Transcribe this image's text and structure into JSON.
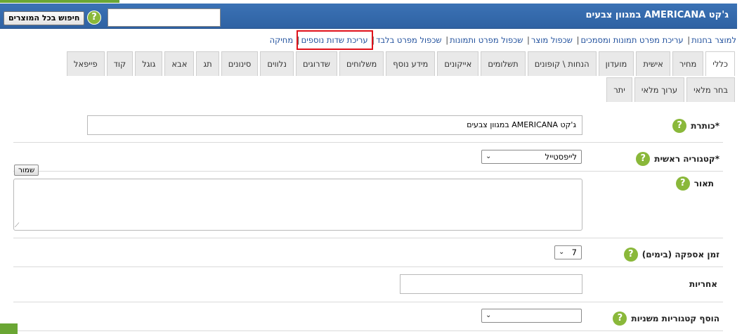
{
  "header": {
    "title": "ג'קט AMERICANA במגוון צבעים",
    "search_button": "חיפוש בכל המוצרים",
    "search_value": "",
    "help": "?"
  },
  "links": [
    "למוצר בחנות",
    "עריכת מפרט תמונות ומסמכים",
    "שכפול מוצר",
    "שכפול מפרט ותמונות",
    "שכפול מפרט בלבד",
    "עריכת שדות נוספים",
    "מחיקה"
  ],
  "tabs_row1": [
    "כללי",
    "מחיר",
    "אישית",
    "מועדון",
    "הנחות \\ קופונים",
    "תשלומים",
    "אייקונים",
    "מידע נוסף",
    "משלוחים",
    "שדרוגים",
    "נלווים",
    "סינונים",
    "תג",
    "אבא",
    "גוגל",
    "קוד",
    "פייפאל"
  ],
  "tabs_row2": [
    "בחר מלאי",
    "ערוך מלאי",
    "יתר"
  ],
  "form": {
    "title_label": "*כותרת",
    "title_value": "ג'קט AMERICANA במגוון צבעים",
    "main_category_label": "*קטגוריה ראשית",
    "main_category_value": "לייפסטייל",
    "save_button": "שמור",
    "description_label": "תאור",
    "delivery_label": "זמן אספקה (בימים)",
    "delivery_value": "7",
    "warranty_label": "אחריות",
    "warranty_value": "",
    "secondary_categories_label": "הוסף קטגוריות משניות",
    "secondary_categories_value": ""
  },
  "colors": {
    "header_blue": "#2f62a3",
    "help_green": "#8ab83a",
    "highlight_red": "#e0121b"
  }
}
